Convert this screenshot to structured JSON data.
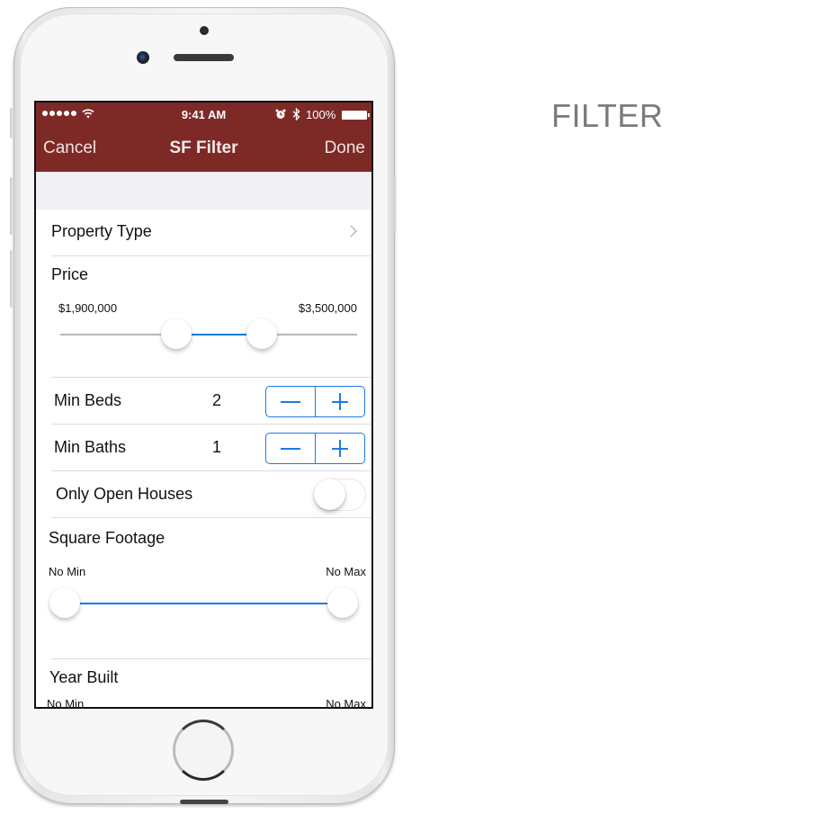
{
  "caption": "FILTER",
  "status_bar": {
    "signal_dots": 5,
    "time": "9:41 AM",
    "battery_percent": "100%",
    "icons": [
      "signal-icon",
      "wifi-icon",
      "alarm-icon",
      "bluetooth-icon",
      "battery-icon"
    ]
  },
  "nav": {
    "cancel_label": "Cancel",
    "title": "SF Filter",
    "done_label": "Done"
  },
  "colors": {
    "nav_background": "#7d2a27",
    "accent": "#1b7ae6",
    "section_background": "#efeff4"
  },
  "filters": {
    "property_type": {
      "label": "Property Type"
    },
    "price": {
      "label": "Price",
      "min_label": "$1,900,000",
      "max_label": "$3,500,000",
      "min_fraction": 0.39,
      "max_fraction": 0.68
    },
    "min_beds": {
      "label": "Min Beds",
      "value": "2",
      "minus": "−",
      "plus": "+"
    },
    "min_baths": {
      "label": "Min Baths",
      "value": "1",
      "minus": "−",
      "plus": "+"
    },
    "open_houses": {
      "label": "Only Open Houses",
      "on": false
    },
    "square_footage": {
      "label": "Square Footage",
      "min_label": "No Min",
      "max_label": "No Max",
      "min_fraction": 0.0,
      "max_fraction": 1.0
    },
    "year_built": {
      "label": "Year Built",
      "min_label": "No Min",
      "max_label": "No Max"
    }
  }
}
